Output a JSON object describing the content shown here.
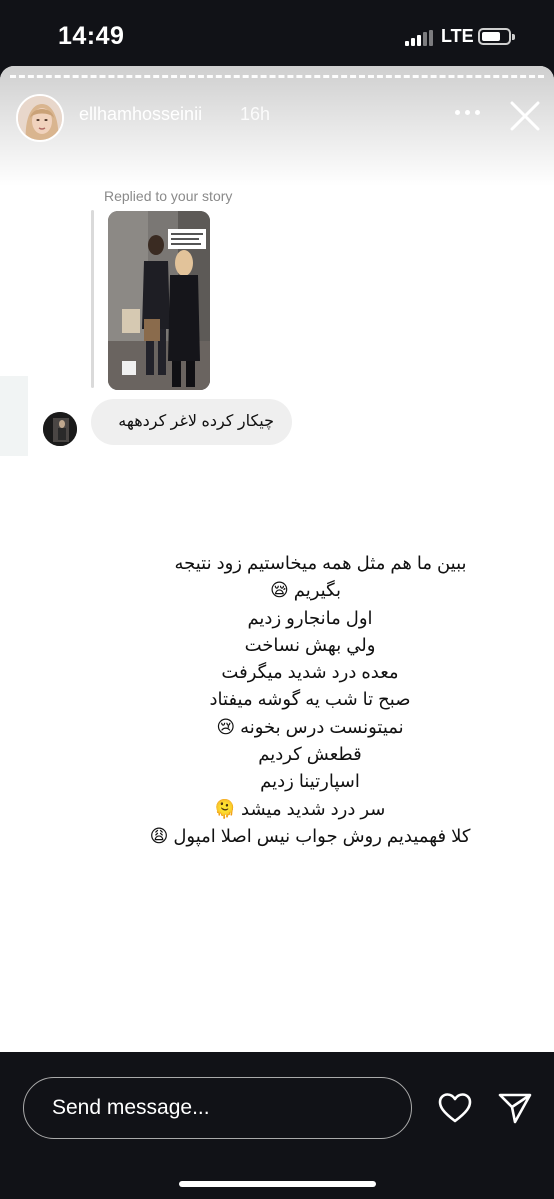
{
  "status_bar": {
    "time": "14:49",
    "network": "LTE",
    "battery_fraction": 0.7
  },
  "story": {
    "username": "ellhamhosseinii",
    "age": "16h",
    "replied_label": "Replied to your story",
    "reply_message": "چیکار کرده لاغر کردههه",
    "message_lines": [
      "ببین ما هم مثل همه میخاستیم زود نتیجه",
      "بگیریم 😪",
      "اول مانجارو زدیم",
      "ولي بهش نساخت",
      "معده درد شدید میگرفت",
      "صبح تا شب یه گوشه میفتاد",
      "نمیتونست درس بخونه 😢",
      "قطعش کردیم",
      "اسپارتینا زدیم",
      "سر درد شدید میشد 🫠",
      "کلا فهمیدیم روش جواب نیس اصلا امپول 😩"
    ]
  },
  "composer": {
    "placeholder": "Send message..."
  },
  "icons": {
    "more": "more-horizontal-icon",
    "close": "close-icon",
    "like": "heart-icon",
    "send": "send-icon"
  },
  "colors": {
    "background": "#111217",
    "story_bg": "#ffffff",
    "bubble": "#efefef"
  }
}
